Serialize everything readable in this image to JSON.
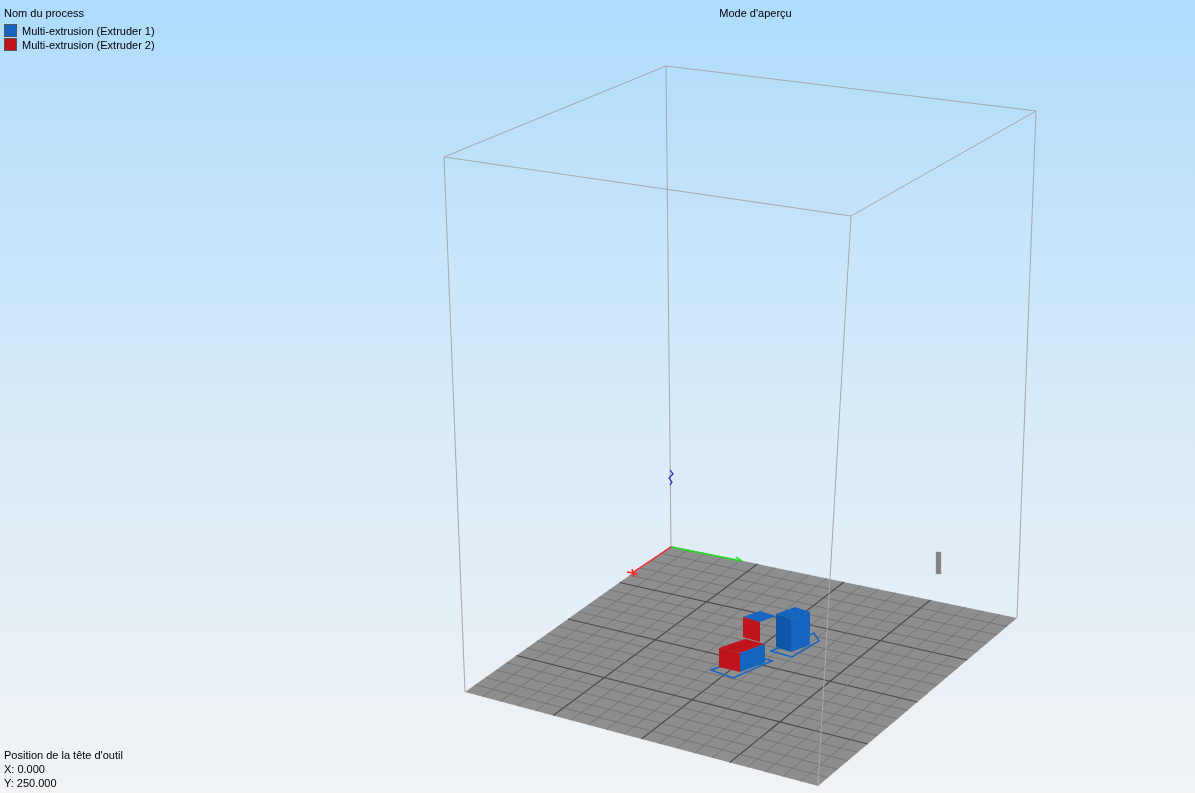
{
  "view_title": "Mode d'aperçu",
  "legend": {
    "title": "Nom du process",
    "items": [
      {
        "label": "Multi-extrusion (Extruder 1)",
        "color": "#1565c0"
      },
      {
        "label": "Multi-extrusion (Extruder 2)",
        "color": "#c0141c"
      }
    ]
  },
  "tool_position": {
    "title": "Position de la tête d'outil",
    "x": "X: 0.000",
    "y": "Y: 250.000"
  }
}
